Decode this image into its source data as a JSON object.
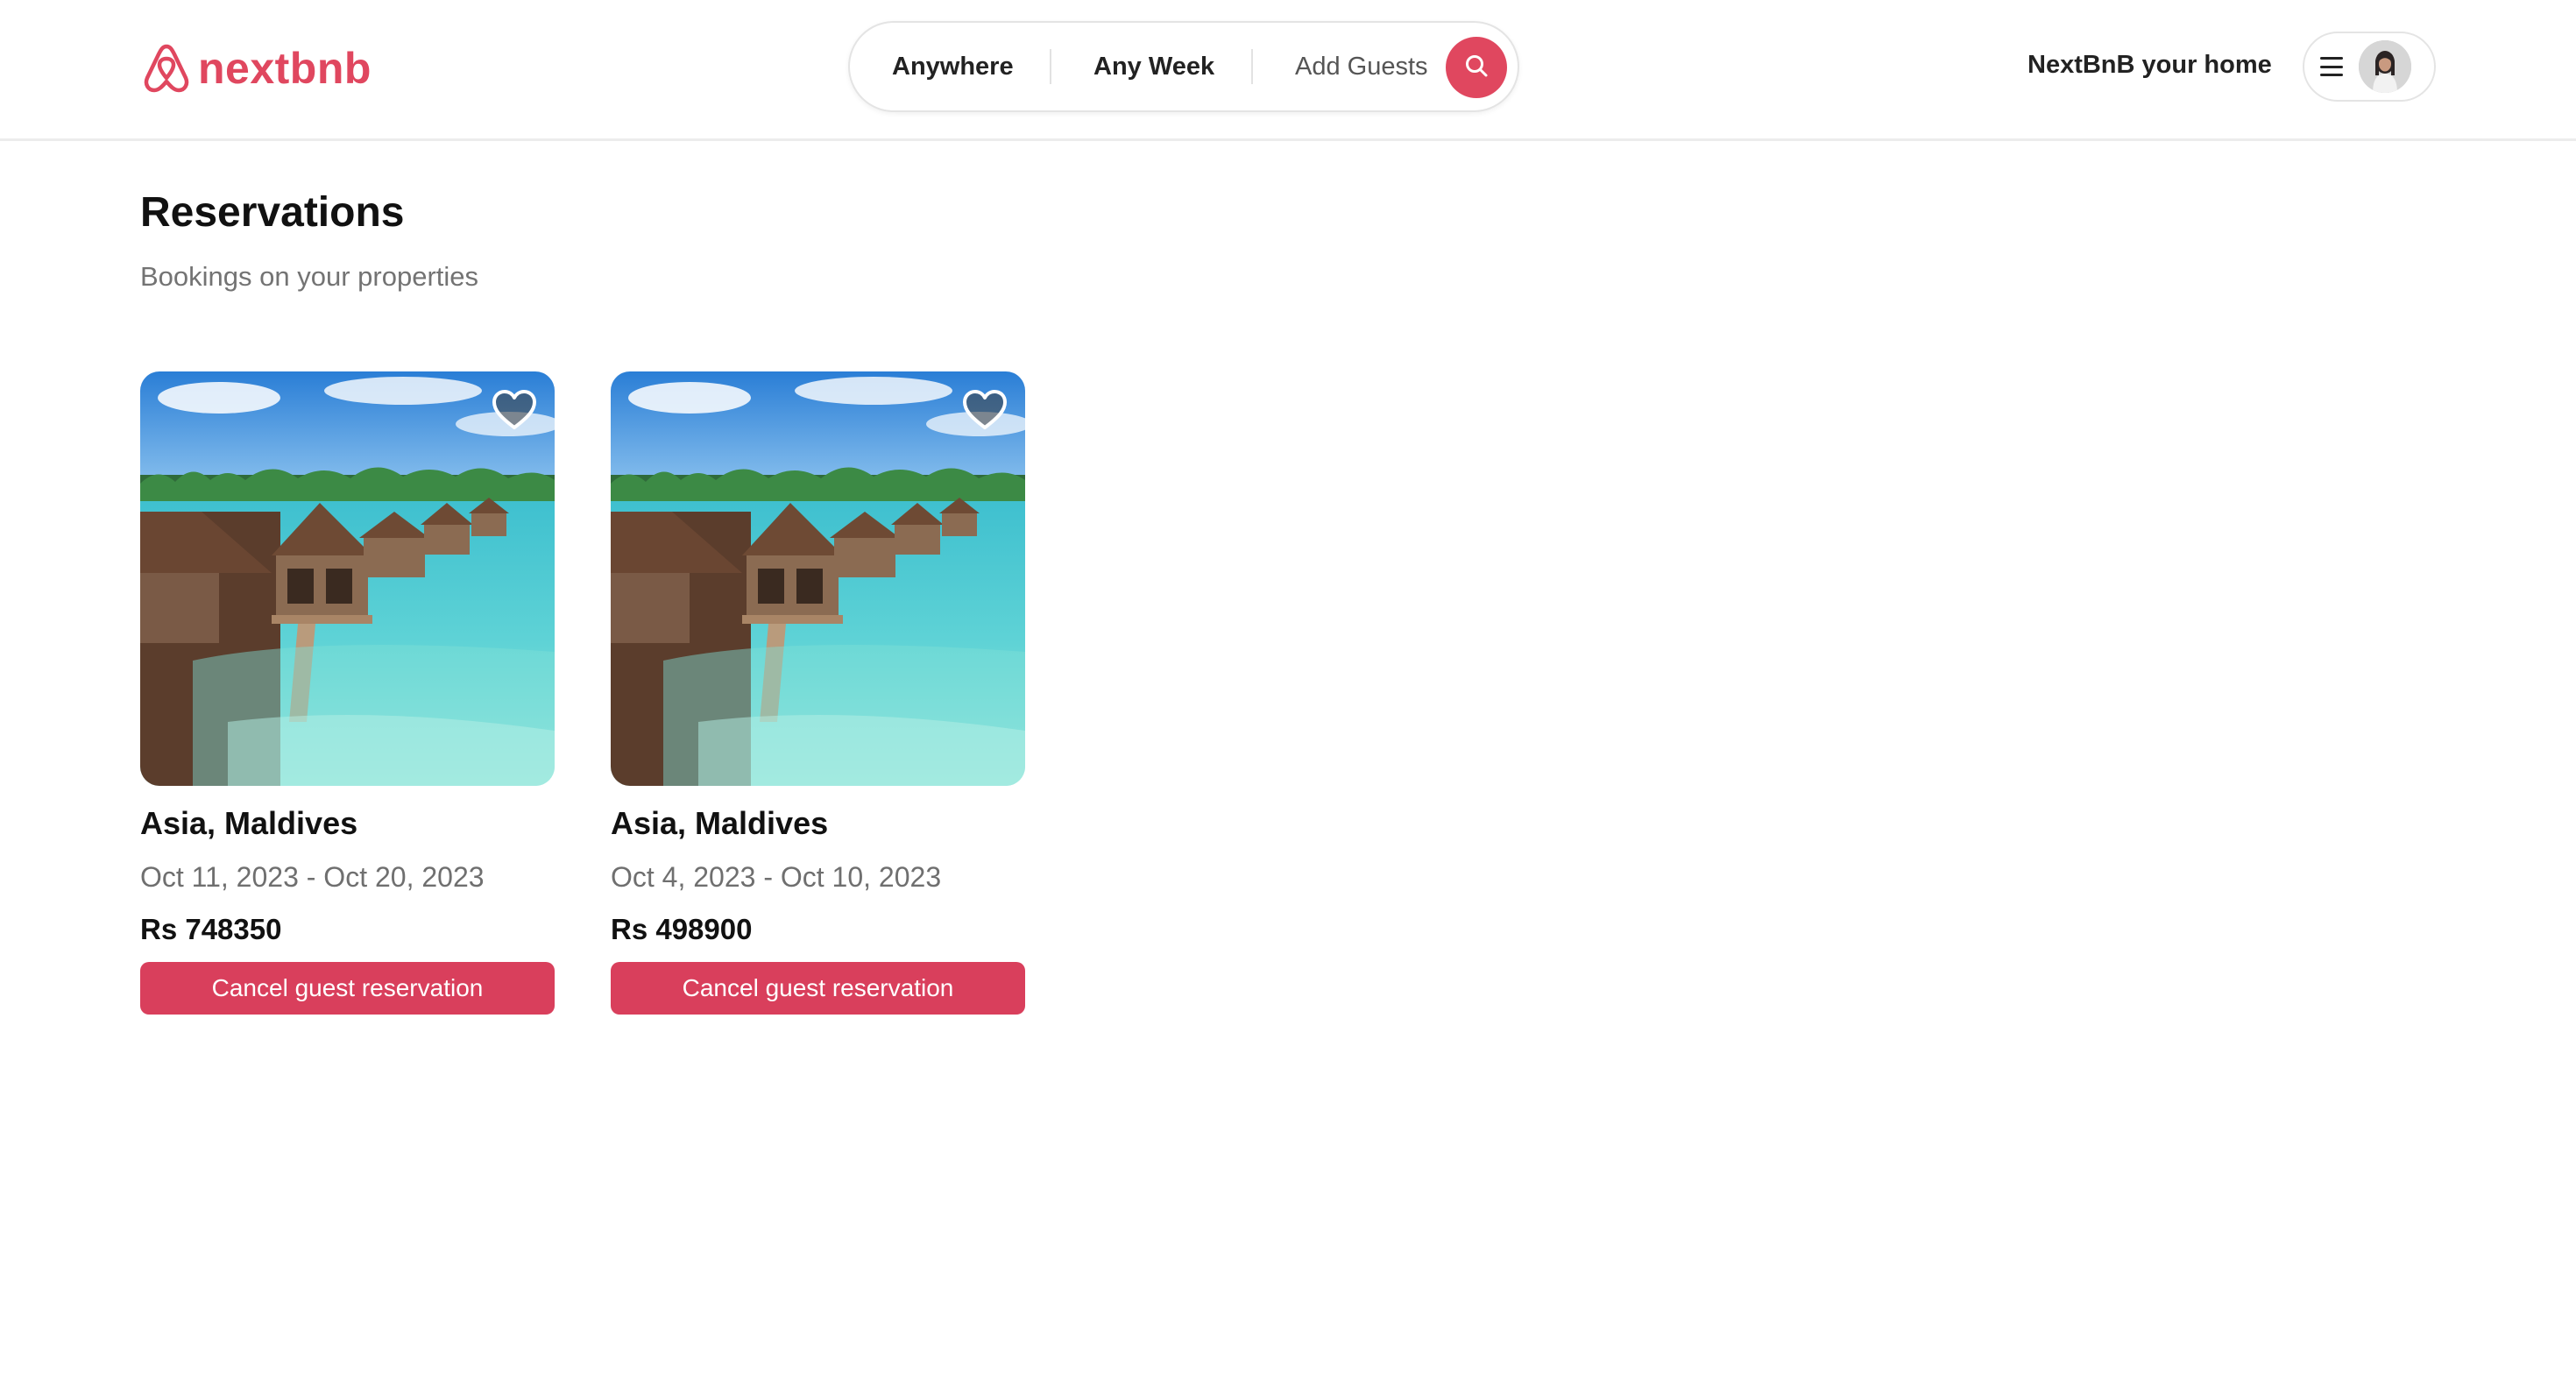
{
  "brand": {
    "name": "nextbnb",
    "accent_color": "#e0475f",
    "logo_icon": "airbnb-belo-icon"
  },
  "search": {
    "location_label": "Anywhere",
    "week_label": "Any Week",
    "guests_label": "Add Guests",
    "button_icon": "search-icon"
  },
  "header": {
    "host_link": "NextBnB your home",
    "menu_icon": "hamburger-menu-icon",
    "avatar_icon": "user-avatar"
  },
  "page": {
    "title": "Reservations",
    "subtitle": "Bookings on your properties"
  },
  "reservations": [
    {
      "location": "Asia, Maldives",
      "dates": "Oct 11, 2023 - Oct 20, 2023",
      "price": "Rs 748350",
      "action_label": "Cancel guest reservation",
      "favorite_icon": "heart-icon"
    },
    {
      "location": "Asia, Maldives",
      "dates": "Oct 4, 2023 - Oct 10, 2023",
      "price": "Rs 498900",
      "action_label": "Cancel guest reservation",
      "favorite_icon": "heart-icon"
    }
  ],
  "colors": {
    "button": "#d93f5c",
    "muted_text": "#737373"
  }
}
